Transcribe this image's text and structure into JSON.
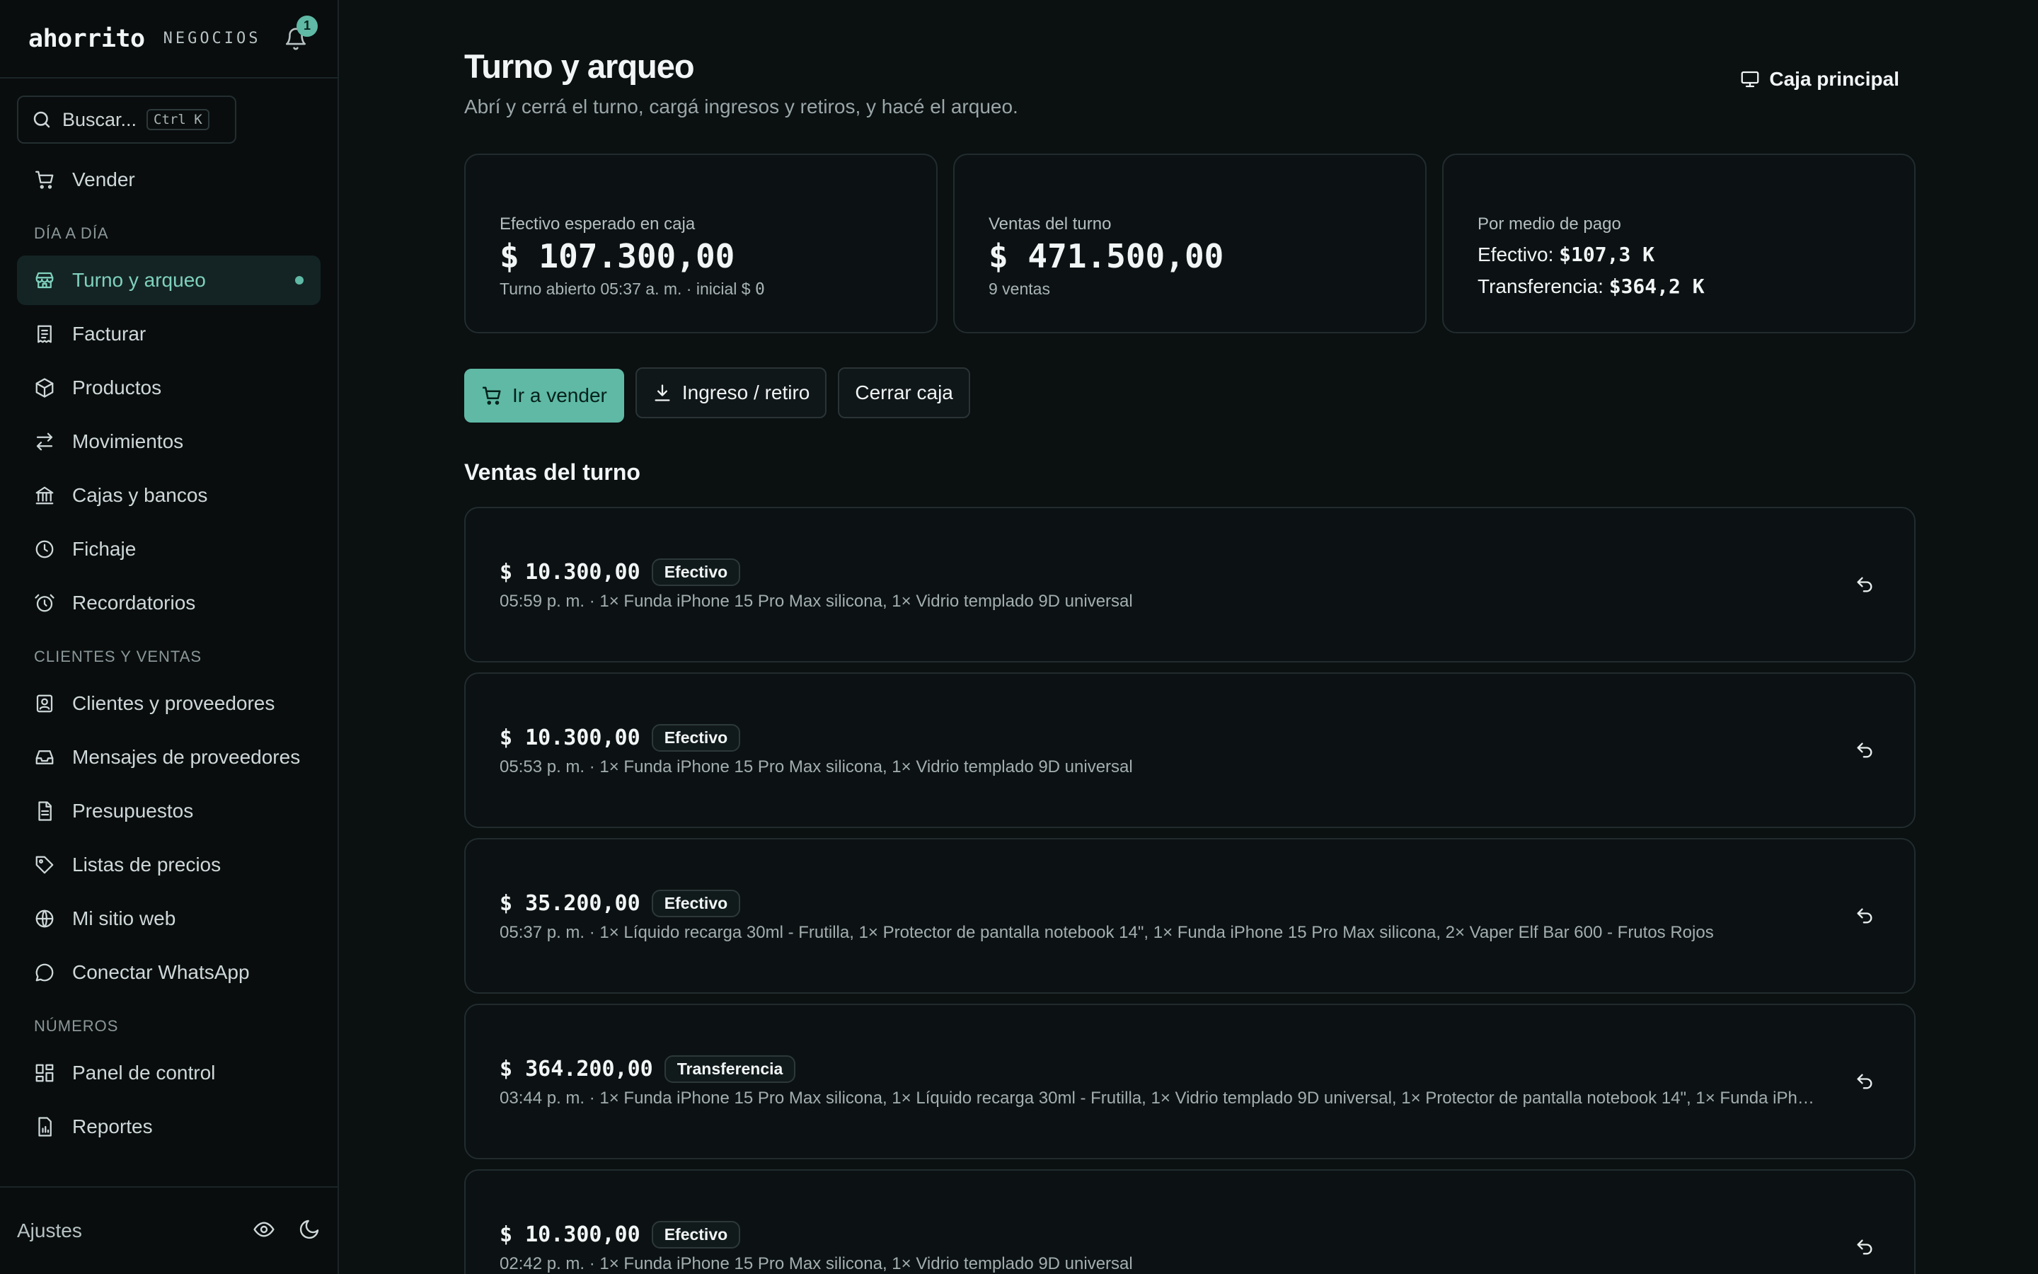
{
  "sidebar": {
    "brand": "ahorrito",
    "brand_sub": "NEGOCIOS",
    "notifications": "1",
    "search": {
      "placeholder": "Buscar...",
      "shortcut": "Ctrl K"
    },
    "top_item": {
      "label": "Vender",
      "icon": "cart-icon"
    },
    "sections": [
      {
        "title": "DÍA A DÍA",
        "items": [
          {
            "label": "Turno y arqueo",
            "icon": "store-icon",
            "active": true
          },
          {
            "label": "Facturar",
            "icon": "receipt-icon"
          },
          {
            "label": "Productos",
            "icon": "box-icon"
          },
          {
            "label": "Movimientos",
            "icon": "arrows-icon"
          },
          {
            "label": "Cajas y bancos",
            "icon": "bank-icon"
          },
          {
            "label": "Fichaje",
            "icon": "clock-icon"
          },
          {
            "label": "Recordatorios",
            "icon": "alarm-icon"
          }
        ]
      },
      {
        "title": "CLIENTES Y VENTAS",
        "items": [
          {
            "label": "Clientes y proveedores",
            "icon": "contacts-icon"
          },
          {
            "label": "Mensajes de proveedores",
            "icon": "inbox-icon"
          },
          {
            "label": "Presupuestos",
            "icon": "document-icon"
          },
          {
            "label": "Listas de precios",
            "icon": "tag-icon"
          },
          {
            "label": "Mi sitio web",
            "icon": "globe-icon"
          },
          {
            "label": "Conectar WhatsApp",
            "icon": "chat-icon"
          }
        ]
      },
      {
        "title": "NÚMEROS",
        "items": [
          {
            "label": "Panel de control",
            "icon": "dashboard-icon"
          },
          {
            "label": "Reportes",
            "icon": "report-icon"
          }
        ]
      }
    ],
    "footer": {
      "settings": "Ajustes"
    }
  },
  "header": {
    "title": "Turno y arqueo",
    "subtitle": "Abrí y cerrá el turno, cargá ingresos y retiros, y hacé el arqueo.",
    "register": "Caja principal"
  },
  "stats": {
    "cash": {
      "label": "Efectivo esperado en caja",
      "value": "$ 107.300,00",
      "note": "Turno abierto 05:37 a. m. · inicial $",
      "note_value": "0"
    },
    "sales": {
      "label": "Ventas del turno",
      "value": "$ 471.500,00",
      "note": "9 ventas"
    },
    "payments": {
      "label": "Por medio de pago",
      "cash_label": "Efectivo:",
      "cash_value": "$107,3 K",
      "transfer_label": "Transferencia:",
      "transfer_value": "$364,2 K"
    }
  },
  "actions": {
    "sell": "Ir a vender",
    "movement": "Ingreso / retiro",
    "close": "Cerrar caja"
  },
  "sales_section": {
    "title": "Ventas del turno",
    "items": [
      {
        "amount": "$ 10.300,00",
        "method": "Efectivo",
        "detail": "05:59 p. m. · 1× Funda iPhone 15 Pro Max silicona, 1× Vidrio templado 9D universal"
      },
      {
        "amount": "$ 10.300,00",
        "method": "Efectivo",
        "detail": "05:53 p. m. · 1× Funda iPhone 15 Pro Max silicona, 1× Vidrio templado 9D universal"
      },
      {
        "amount": "$ 35.200,00",
        "method": "Efectivo",
        "detail": "05:37 p. m. · 1× Líquido recarga 30ml - Frutilla, 1× Protector de pantalla notebook 14\", 1× Funda iPhone 15 Pro Max silicona, 2× Vaper Elf Bar 600 - Frutos Rojos"
      },
      {
        "amount": "$ 364.200,00",
        "method": "Transferencia",
        "detail": "03:44 p. m. · 1× Funda iPhone 15 Pro Max silicona, 1× Líquido recarga 30ml - Frutilla, 1× Vidrio templado 9D universal, 1× Protector de pantalla notebook 14\", 1× Funda iPhone..."
      },
      {
        "amount": "$ 10.300,00",
        "method": "Efectivo",
        "detail": "02:42 p. m. · 1× Funda iPhone 15 Pro Max silicona, 1× Vidrio templado 9D universal"
      }
    ]
  },
  "colors": {
    "accent": "#5fb9a5",
    "background": "#0b1011",
    "sidebar": "#090d0e",
    "card_border": "#222c2e"
  }
}
